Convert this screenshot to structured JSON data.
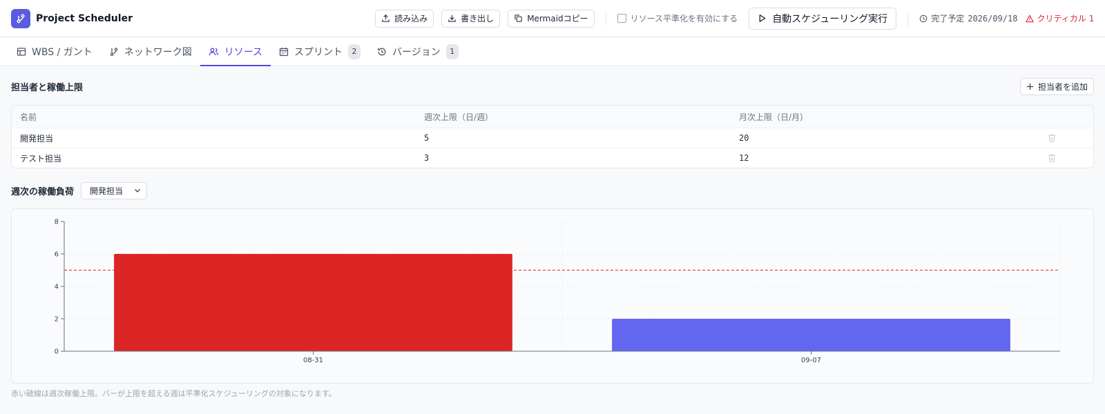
{
  "header": {
    "app_title": "Project Scheduler",
    "import_label": "読み込み",
    "export_label": "書き出し",
    "mermaid_label": "Mermaidコピー",
    "leveling_label": "リソース平準化を有効にする",
    "run_label": "自動スケジューリング実行",
    "due_label": "完了予定",
    "due_date": "2026/09/18",
    "critical_label": "クリティカル",
    "critical_count": "1"
  },
  "tabs": [
    {
      "label": "WBS / ガント",
      "icon": "table-icon"
    },
    {
      "label": "ネットワーク図",
      "icon": "git-branch-icon"
    },
    {
      "label": "リソース",
      "icon": "users-icon",
      "active": true
    },
    {
      "label": "スプリント",
      "icon": "calendar-icon",
      "badge": "2"
    },
    {
      "label": "バージョン",
      "icon": "history-icon",
      "badge": "1"
    }
  ],
  "resources": {
    "title": "担当者と稼働上限",
    "add_label": "担当者を追加",
    "columns": [
      "名前",
      "週次上限（日/週）",
      "月次上限（日/月）"
    ],
    "rows": [
      {
        "name": "開発担当",
        "weekly": "5",
        "monthly": "20"
      },
      {
        "name": "テスト担当",
        "weekly": "3",
        "monthly": "12"
      }
    ]
  },
  "load": {
    "title": "週次の稼働負荷",
    "selected": "開発担当",
    "note": "赤い破線は週次稼働上限。バーが上限を超える週は平準化スケジューリングの対象になります。"
  },
  "colors": {
    "accent": "#4f46e5",
    "over": "#dc2626",
    "normal": "#6366f1",
    "limit_line": "#dc2626"
  },
  "chart_data": {
    "type": "bar",
    "categories": [
      "08-31",
      "09-07"
    ],
    "values": [
      6,
      2
    ],
    "limit": 5,
    "ylim": [
      0,
      8
    ],
    "yticks": [
      0,
      2,
      4,
      6,
      8
    ],
    "grid": true
  }
}
